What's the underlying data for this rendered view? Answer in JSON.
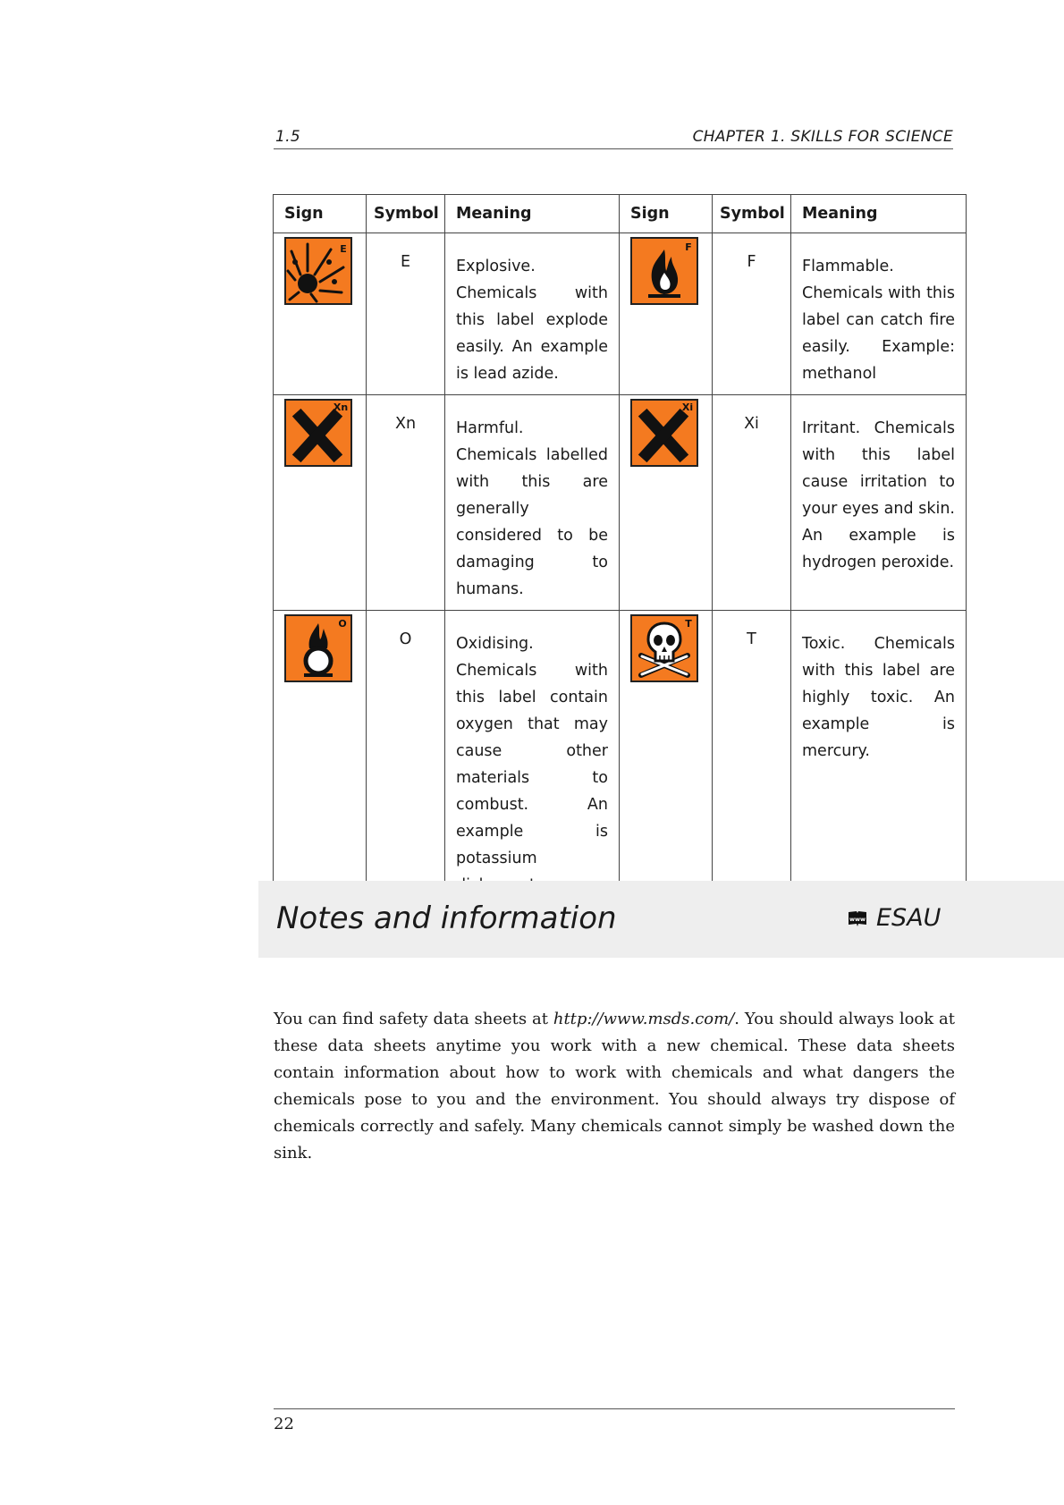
{
  "header": {
    "section": "1.5",
    "chapter": "CHAPTER 1.  SKILLS FOR SCIENCE"
  },
  "table": {
    "headers": [
      "Sign",
      "Symbol",
      "Meaning",
      "Sign",
      "Symbol",
      "Meaning"
    ],
    "rows": [
      [
        {
          "icon": "explosive-icon",
          "symbol": "E",
          "meaning": "Explosive. Chemicals with this label explode easily. An example is lead azide."
        },
        {
          "icon": "flammable-icon",
          "symbol": "F",
          "meaning": "Flammable. Chemicals with this label can catch fire easily. Example: methanol"
        }
      ],
      [
        {
          "icon": "harmful-icon",
          "symbol": "Xn",
          "meaning": "Harmful. Chemicals labelled with this are generally considered to be damaging to humans."
        },
        {
          "icon": "irritant-icon",
          "symbol": "Xi",
          "meaning": "Irritant. Chemicals with this label cause irritation to your eyes and skin. An example is hydrogen peroxide."
        }
      ],
      [
        {
          "icon": "oxidising-icon",
          "symbol": "O",
          "meaning": "Oxidising. Chemicals with this label contain oxygen that may cause other materials to combust. An example is potassium dichromate."
        },
        {
          "icon": "toxic-icon",
          "symbol": "T",
          "meaning": "Toxic. Chemicals with this label are highly toxic. An example is mercury."
        }
      ]
    ]
  },
  "notes": {
    "title": "Notes and information",
    "code": "ESAU",
    "paragraph": {
      "before": "You can find safety data sheets at ",
      "link": "http://www.msds.com/",
      "after": ". You should always look at these data sheets anytime you work with a new chemical. These data sheets contain information about how to work with chemicals and what dangers the chemicals pose to you and the environment.  You should always try dispose of chemicals correctly and safely.  Many chemicals cannot simply be washed down the sink."
    }
  },
  "footer": {
    "page_number": "22"
  },
  "colors": {
    "hazard_orange": "#f47a20",
    "banner_gray": "#eeeeee"
  }
}
